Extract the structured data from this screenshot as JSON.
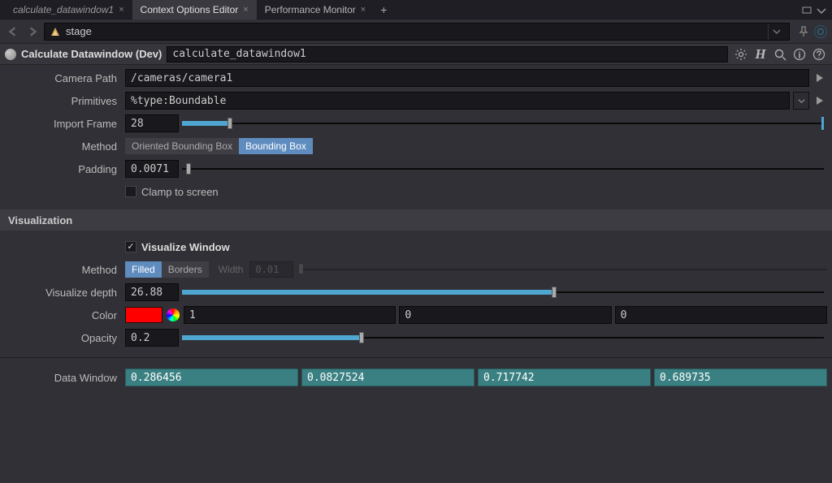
{
  "tabs": [
    {
      "label": "calculate_datawindow1",
      "active": false,
      "italic": true
    },
    {
      "label": "Context Options Editor",
      "active": true,
      "italic": false
    },
    {
      "label": "Performance Monitor",
      "active": false,
      "italic": false
    }
  ],
  "path": "stage",
  "node": {
    "title": "Calculate Datawindow (Dev)",
    "name": "calculate_datawindow1"
  },
  "params": {
    "camera_path": {
      "label": "Camera Path",
      "value": "/cameras/camera1"
    },
    "primitives": {
      "label": "Primitives",
      "value": "%type:Boundable"
    },
    "import_frame": {
      "label": "Import Frame",
      "value": "28",
      "pct": 7.5
    },
    "method": {
      "label": "Method",
      "options": [
        "Oriented Bounding Box",
        "Bounding Box"
      ],
      "selected": 1
    },
    "padding": {
      "label": "Padding",
      "value": "0.0071",
      "pct": 1
    },
    "clamp_to_screen": {
      "label": "Clamp to screen",
      "checked": false
    }
  },
  "visualization": {
    "header": "Visualization",
    "visualize_window": {
      "label": "Visualize Window",
      "checked": true
    },
    "method": {
      "label": "Method",
      "options": [
        "Filled",
        "Borders"
      ],
      "selected": 0,
      "width_label": "Width",
      "width_value": "0.01"
    },
    "visualize_depth": {
      "label": "Visualize depth",
      "value": "26.88",
      "pct": 58
    },
    "color": {
      "label": "Color",
      "hex": "#ff0000",
      "r": "1",
      "g": "0",
      "b": "0"
    },
    "opacity": {
      "label": "Opacity",
      "value": "0.2",
      "pct": 28
    }
  },
  "data_window": {
    "label": "Data Window",
    "values": [
      "0.286456",
      "0.0827524",
      "0.717742",
      "0.689735"
    ]
  }
}
